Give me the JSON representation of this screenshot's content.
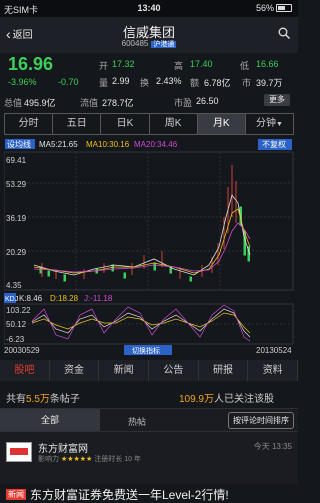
{
  "status": {
    "carrier": "无SIM卡",
    "time": "13:40",
    "battery": "56%"
  },
  "nav": {
    "back_label": "返回",
    "title": "信威集团",
    "code": "600485",
    "market_tag": "沪港通"
  },
  "quote": {
    "price": "16.96",
    "change_pct": "-3.96%",
    "change": "-0.70",
    "open_label": "开",
    "open": "17.32",
    "high_label": "高",
    "high": "17.40",
    "low_label": "低",
    "low": "16.66",
    "volratio_label": "量",
    "volratio": "2.99",
    "turnover_label": "换",
    "turnover": "2.43%",
    "amount_label": "额",
    "amount": "6.78亿",
    "mkt_label": "市",
    "mkt": "39.7万",
    "total_cap_label": "总值",
    "total_cap": "495.9亿",
    "float_cap_label": "流值",
    "float_cap": "278.7亿",
    "pe_label": "市盈",
    "pe": "26.50",
    "more_label": "更多"
  },
  "tabs": [
    "分时",
    "五日",
    "日K",
    "周K",
    "月K",
    "分钟"
  ],
  "tab_more": "▼",
  "chart_labels": {
    "setline": "设均线",
    "ma5": "MA5:21.65",
    "ma10": "MA10:30.16",
    "ma20": "MA20:34.46",
    "nofq": "不复权",
    "y_max": "69.41",
    "y1": "53.29",
    "y2": "36.19",
    "y3": "20.29",
    "y_min": "4.35",
    "kdj": "KDJ",
    "k": "K:8.46",
    "d": "D:18.28",
    "j": "J:-11.18",
    "kd_top": "103.22",
    "kd_mid": "50.12",
    "kd_bot": "-6.23",
    "date_start": "20030529",
    "date_end": "20130524",
    "toggle": "切换指标"
  },
  "btabs": [
    "股吧",
    "资金",
    "新闻",
    "公告",
    "研报",
    "资料"
  ],
  "posts": {
    "prefix": "共有",
    "count": "5.5万",
    "suffix": "条帖子",
    "att_count": "109.9万",
    "att_suffix": "人已关注该股"
  },
  "filter": {
    "all": "全部",
    "hot": "热帖",
    "sort": "按评论时间排序"
  },
  "post": {
    "name": "东方财富网",
    "grade_label": "影响力",
    "stars": "★★★★★",
    "age": "注册时长 10 年",
    "time": "今天 13:35",
    "avatar_label": "东方财富网"
  },
  "news": {
    "badge": "新闻",
    "text": "东方财富证券免费送一年Level-2行情!"
  },
  "colors": {
    "up": "#e8473c",
    "down": "#3ccf5a",
    "active_tab": "#383b42"
  }
}
